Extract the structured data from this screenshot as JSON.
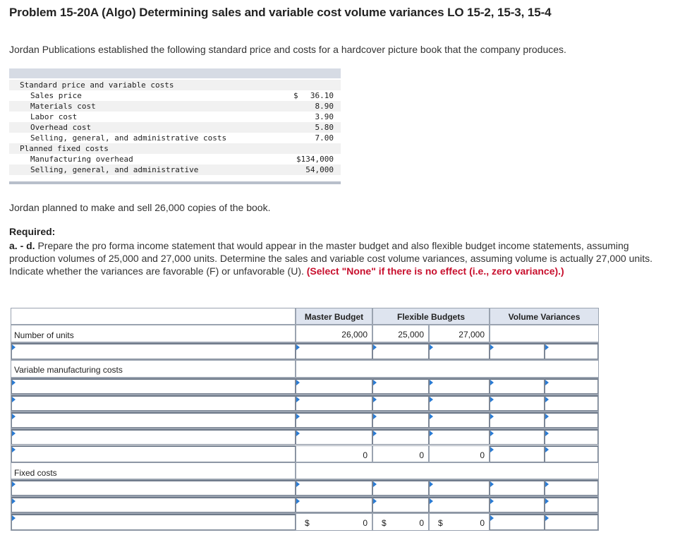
{
  "title": "Problem 15-20A (Algo) Determining sales and variable cost volume variances LO 15-2, 15-3, 15-4",
  "intro": "Jordan Publications established the following standard price and costs for a hardcover picture book that the company produces.",
  "standard": {
    "rows": [
      {
        "label": "Standard price and variable costs",
        "indent": 0,
        "dollar": "",
        "value": ""
      },
      {
        "label": "Sales price",
        "indent": 1,
        "dollar": "$",
        "value": "36.10"
      },
      {
        "label": "Materials cost",
        "indent": 1,
        "dollar": "",
        "value": "8.90"
      },
      {
        "label": "Labor cost",
        "indent": 1,
        "dollar": "",
        "value": "3.90"
      },
      {
        "label": "Overhead cost",
        "indent": 1,
        "dollar": "",
        "value": "5.80"
      },
      {
        "label": "Selling, general, and administrative costs",
        "indent": 1,
        "dollar": "",
        "value": "7.00"
      },
      {
        "label": "Planned fixed costs",
        "indent": 0,
        "dollar": "",
        "value": ""
      },
      {
        "label": "Manufacturing overhead",
        "indent": 1,
        "dollar": "",
        "value": "$134,000"
      },
      {
        "label": "Selling, general, and administrative",
        "indent": 1,
        "dollar": "",
        "value": "54,000"
      }
    ]
  },
  "plan_text": "Jordan planned to make and sell 26,000 copies of the book.",
  "required_head": "Required:",
  "required_prefix": "a. - d.",
  "required_text": " Prepare the pro forma income statement that would appear in the master budget and also flexible budget income statements, assuming production volumes of 25,000 and 27,000 units. Determine the sales and variable cost volume variances, assuming volume is actually 27,000 units. Indicate whether the variances are favorable (F) or unfavorable (U). ",
  "required_note": "(Select \"None\" if there is no effect (i.e., zero variance).)",
  "table": {
    "headers": {
      "master": "Master Budget",
      "flexible": "Flexible Budgets",
      "variances": "Volume Variances"
    },
    "units_label": "Number of units",
    "units": {
      "master": "26,000",
      "flex1": "25,000",
      "flex2": "27,000"
    },
    "variable_label": "Variable manufacturing costs",
    "subtotal": {
      "master": "0",
      "flex1": "0",
      "flex2": "0"
    },
    "fixed_label": "Fixed costs",
    "total": {
      "dollar": "$",
      "master": "0",
      "flex1": "0",
      "flex2": "0"
    }
  }
}
